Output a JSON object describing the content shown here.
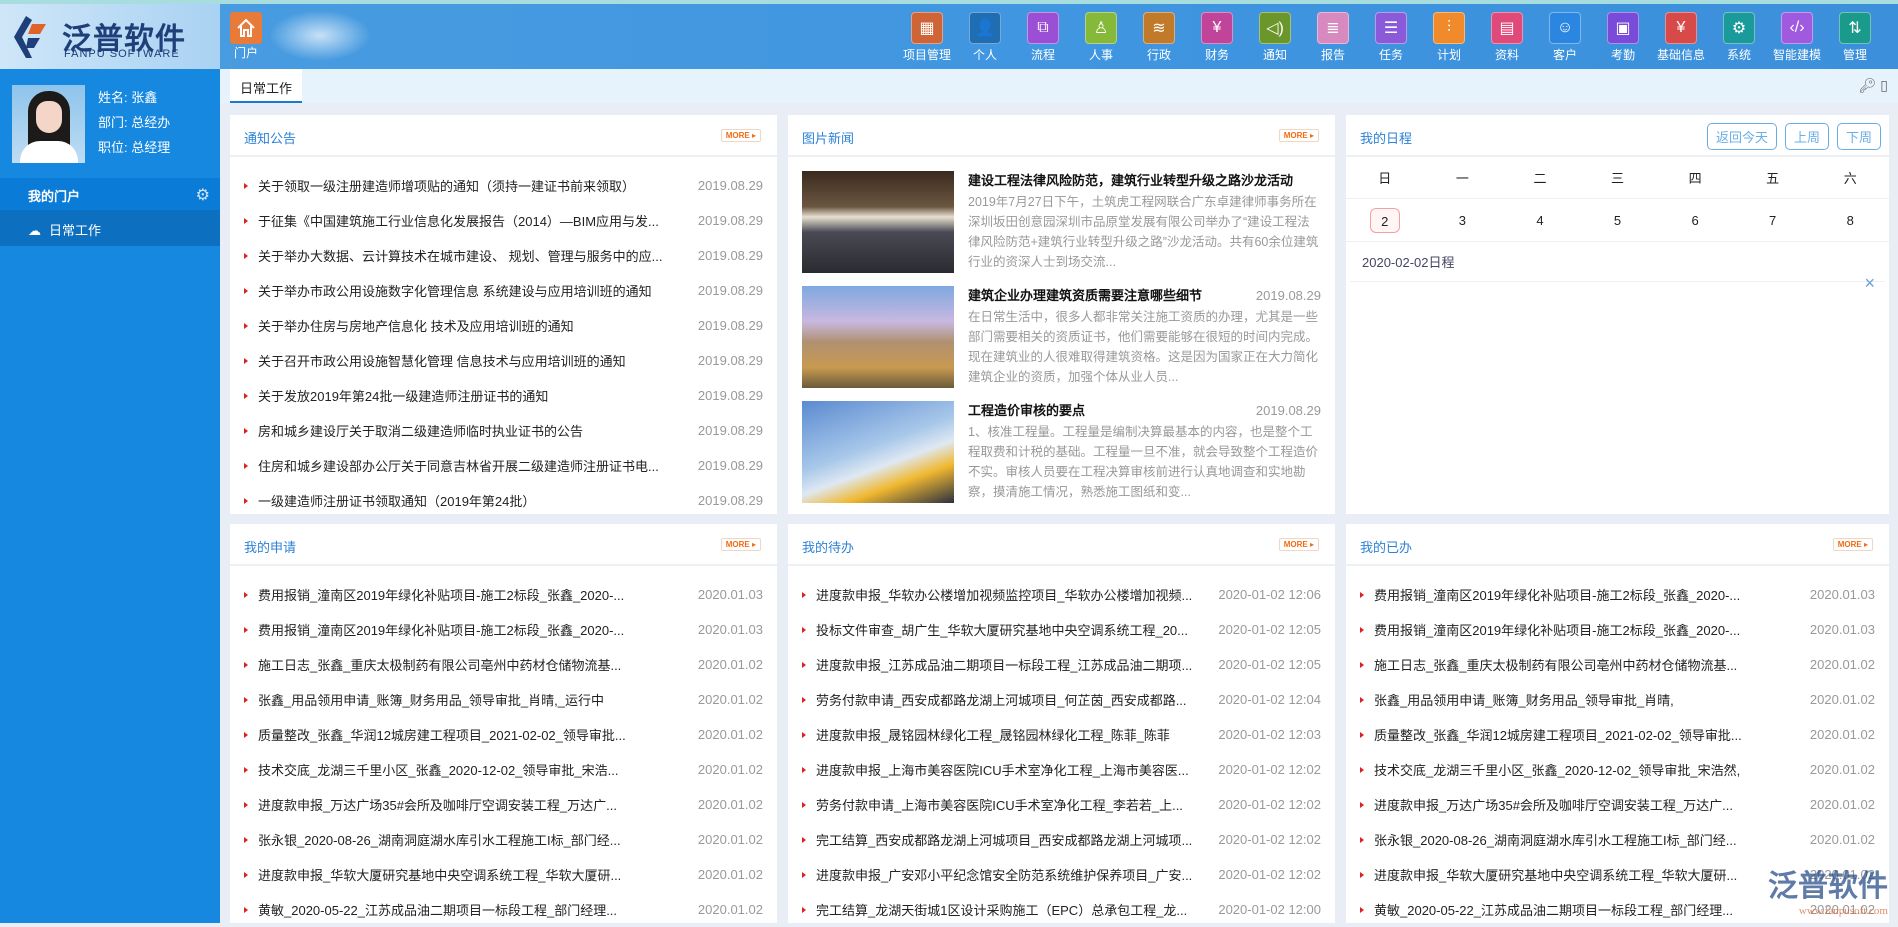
{
  "header": {
    "logo_cn": "泛普软件",
    "logo_en": "FANPU SOFTWARE",
    "home_label": "门户",
    "nav": [
      {
        "label": "项目管理",
        "icon": "grid-icon",
        "color": "#cf6437",
        "g": "▦"
      },
      {
        "label": "个人",
        "icon": "person-icon",
        "color": "#1f6db3",
        "g": "👤"
      },
      {
        "label": "流程",
        "icon": "flow-icon",
        "color": "#9a4fd4",
        "g": "⧉"
      },
      {
        "label": "人事",
        "icon": "hr-icon",
        "color": "#86b83a",
        "g": "♙"
      },
      {
        "label": "行政",
        "icon": "layers-icon",
        "color": "#c07a2a",
        "g": "≋"
      },
      {
        "label": "财务",
        "icon": "finance-icon",
        "color": "#c0449a",
        "g": "¥"
      },
      {
        "label": "通知",
        "icon": "speaker-icon",
        "color": "#6a962a",
        "g": "◁)"
      },
      {
        "label": "报告",
        "icon": "report-icon",
        "color": "#d889c0",
        "g": "≣"
      },
      {
        "label": "任务",
        "icon": "task-icon",
        "color": "#8a5ad8",
        "g": "☰"
      },
      {
        "label": "计划",
        "icon": "sliders-icon",
        "color": "#f08a2a",
        "g": "⫶"
      },
      {
        "label": "资料",
        "icon": "document-icon",
        "color": "#e04a7a",
        "g": "▤"
      },
      {
        "label": "客户",
        "icon": "customer-icon",
        "color": "#2a86e0",
        "g": "☺"
      },
      {
        "label": "考勤",
        "icon": "calendar-icon",
        "color": "#7a4ad8",
        "g": "▣"
      },
      {
        "label": "基础信息",
        "icon": "ledger-icon",
        "color": "#d84a4a",
        "g": "¥"
      },
      {
        "label": "系统",
        "icon": "gear-icon",
        "color": "#1a9a9a",
        "g": "⚙"
      },
      {
        "label": "智能建模",
        "icon": "code-icon",
        "color": "#a05ae0",
        "g": "‹/›"
      },
      {
        "label": "管理",
        "icon": "sort-icon",
        "color": "#1a9a8a",
        "g": "⇅"
      }
    ]
  },
  "profile": {
    "name": "姓名: 张鑫",
    "dept": "部门: 总经办",
    "title": "职位: 总经理"
  },
  "sidebar": {
    "section": "我的门户",
    "item": "日常工作"
  },
  "tabs": {
    "active": "日常工作"
  },
  "more_label": "MORE ▸",
  "notices": {
    "title": "通知公告",
    "items": [
      {
        "t": "关于领取一级注册建造师增项贴的通知（须持一建证书前来领取）",
        "d": "2019.08.29"
      },
      {
        "t": "于征集《中国建筑施工行业信息化发展报告（2014）—BIM应用与发...",
        "d": "2019.08.29"
      },
      {
        "t": "关于举办大数据、云计算技术在城市建设、 规划、管理与服务中的应...",
        "d": "2019.08.29"
      },
      {
        "t": "关于举办市政公用设施数字化管理信息 系统建设与应用培训班的通知",
        "d": "2019.08.29"
      },
      {
        "t": "关于举办住房与房地产信息化 技术及应用培训班的通知",
        "d": "2019.08.29"
      },
      {
        "t": "关于召开市政公用设施智慧化管理 信息技术与应用培训班的通知",
        "d": "2019.08.29"
      },
      {
        "t": "关于发放2019年第24批一级建造师注册证书的通知",
        "d": "2019.08.29"
      },
      {
        "t": "房和城乡建设厅关于取消二级建造师临时执业证书的公告",
        "d": "2019.08.29"
      },
      {
        "t": "住房和城乡建设部办公厅关于同意吉林省开展二级建造师注册证书电...",
        "d": "2019.08.29"
      },
      {
        "t": "一级建造师注册证书领取通知（2019年第24批）",
        "d": "2019.08.29"
      }
    ]
  },
  "news": {
    "title": "图片新闻",
    "items": [
      {
        "t": "建设工程法律风险防范，建筑行业转型升级之路沙龙活动",
        "d": "",
        "desc": "2019年7月27日下午，土筑虎工程网联合广东卓建律师事务所在深圳坂田创意园深圳市品原堂发展有限公司举办了“建设工程法律风险防范+建筑行业转型升级之路”沙龙活动。共有60余位建筑行业的资深人士到场交流..."
      },
      {
        "t": "建筑企业办理建筑资质需要注意哪些细节",
        "d": "2019.08.29",
        "desc": "在日常生活中，很多人都非常关注施工资质的办理，尤其是一些部门需要相关的资质证书，他们需要能够在很短的时间内完成。现在建筑业的人很难取得建筑资格。这是因为国家正在大力简化建筑企业的资质，加强个体从业人员..."
      },
      {
        "t": "工程造价审核的要点",
        "d": "2019.08.29",
        "desc": "1、核准工程量。工程量是编制决算最基本的内容，也是整个工程取费和计税的基础。工程量一旦不准，就会导致整个工程造价不实。审核人员要在工程决算审核前进行认真地调查和实地勘察，摸清施工情况，熟悉施工图纸和变..."
      }
    ]
  },
  "schedule": {
    "title": "我的日程",
    "buttons": [
      "返回今天",
      "上周",
      "下周"
    ],
    "weekdays": [
      "日",
      "一",
      "二",
      "三",
      "四",
      "五",
      "六"
    ],
    "dates": [
      "2",
      "3",
      "4",
      "5",
      "6",
      "7",
      "8"
    ],
    "today_index": 0,
    "label": "2020-02-02日程",
    "close": "×"
  },
  "applications": {
    "title": "我的申请",
    "items": [
      {
        "t": "费用报销_潼南区2019年绿化补贴项目-施工2标段_张鑫_2020-...",
        "d": "2020.01.03"
      },
      {
        "t": "费用报销_潼南区2019年绿化补贴项目-施工2标段_张鑫_2020-...",
        "d": "2020.01.03"
      },
      {
        "t": "施工日志_张鑫_重庆太极制药有限公司亳州中药材仓储物流基...",
        "d": "2020.01.02"
      },
      {
        "t": "张鑫_用品领用申请_账簿_财务用品_领导审批_肖晴,_运行中",
        "d": "2020.01.02"
      },
      {
        "t": "质量整改_张鑫_华润12城房建工程项目_2021-02-02_领导审批...",
        "d": "2020.01.02"
      },
      {
        "t": "技术交底_龙湖三千里小区_张鑫_2020-12-02_领导审批_宋浩...",
        "d": "2020.01.02"
      },
      {
        "t": "进度款申报_万达广场35#会所及咖啡厅空调安装工程_万达广...",
        "d": "2020.01.02"
      },
      {
        "t": "张永银_2020-08-26_湖南洞庭湖水库引水工程施工I标_部门经...",
        "d": "2020.01.02"
      },
      {
        "t": "进度款申报_华软大厦研究基地中央空调系统工程_华软大厦研...",
        "d": "2020.01.02"
      },
      {
        "t": "黄敏_2020-05-22_江苏成品油二期项目一标段工程_部门经理...",
        "d": "2020.01.02"
      }
    ]
  },
  "todo": {
    "title": "我的待办",
    "items": [
      {
        "t": "进度款申报_华软办公楼增加视频监控项目_华软办公楼增加视频...",
        "d": "2020-01-02 12:06"
      },
      {
        "t": "投标文件审查_胡广生_华软大厦研究基地中央空调系统工程_20...",
        "d": "2020-01-02 12:05"
      },
      {
        "t": "进度款申报_江苏成品油二期项目一标段工程_江苏成品油二期项...",
        "d": "2020-01-02 12:05"
      },
      {
        "t": "劳务付款申请_西安成都路龙湖上河城项目_何芷茵_西安成都路...",
        "d": "2020-01-02 12:04"
      },
      {
        "t": "进度款申报_晟铭园林绿化工程_晟铭园林绿化工程_陈菲_陈菲",
        "d": "2020-01-02 12:03"
      },
      {
        "t": "进度款申报_上海市美容医院ICU手术室净化工程_上海市美容医...",
        "d": "2020-01-02 12:02"
      },
      {
        "t": "劳务付款申请_上海市美容医院ICU手术室净化工程_李若若_上...",
        "d": "2020-01-02 12:02"
      },
      {
        "t": "完工结算_西安成都路龙湖上河城项目_西安成都路龙湖上河城项...",
        "d": "2020-01-02 12:02"
      },
      {
        "t": "进度款申报_广安邓小平纪念馆安全防范系统维护保养项目_广安...",
        "d": "2020-01-02 12:02"
      },
      {
        "t": "完工结算_龙湖天街城1区设计采购施工（EPC）总承包工程_龙...",
        "d": "2020-01-02 12:00"
      }
    ]
  },
  "done": {
    "title": "我的已办",
    "items": [
      {
        "t": "费用报销_潼南区2019年绿化补贴项目-施工2标段_张鑫_2020-...",
        "d": "2020.01.03"
      },
      {
        "t": "费用报销_潼南区2019年绿化补贴项目-施工2标段_张鑫_2020-...",
        "d": "2020.01.03"
      },
      {
        "t": "施工日志_张鑫_重庆太极制药有限公司亳州中药材仓储物流基...",
        "d": "2020.01.02"
      },
      {
        "t": "张鑫_用品领用申请_账簿_财务用品_领导审批_肖晴,",
        "d": "2020.01.02"
      },
      {
        "t": "质量整改_张鑫_华润12城房建工程项目_2021-02-02_领导审批...",
        "d": "2020.01.02"
      },
      {
        "t": "技术交底_龙湖三千里小区_张鑫_2020-12-02_领导审批_宋浩然,",
        "d": "2020.01.02"
      },
      {
        "t": "进度款申报_万达广场35#会所及咖啡厅空调安装工程_万达广...",
        "d": "2020.01.02"
      },
      {
        "t": "张永银_2020-08-26_湖南洞庭湖水库引水工程施工I标_部门经...",
        "d": "2020.01.02"
      },
      {
        "t": "进度款申报_华软大厦研究基地中央空调系统工程_华软大厦研...",
        "d": "2020.01.02"
      },
      {
        "t": "黄敏_2020-05-22_江苏成品油二期项目一标段工程_部门经理...",
        "d": "2020.01.02"
      }
    ]
  },
  "watermark": {
    "cn": "泛普软件",
    "url": "www.fanpusoft.com"
  }
}
